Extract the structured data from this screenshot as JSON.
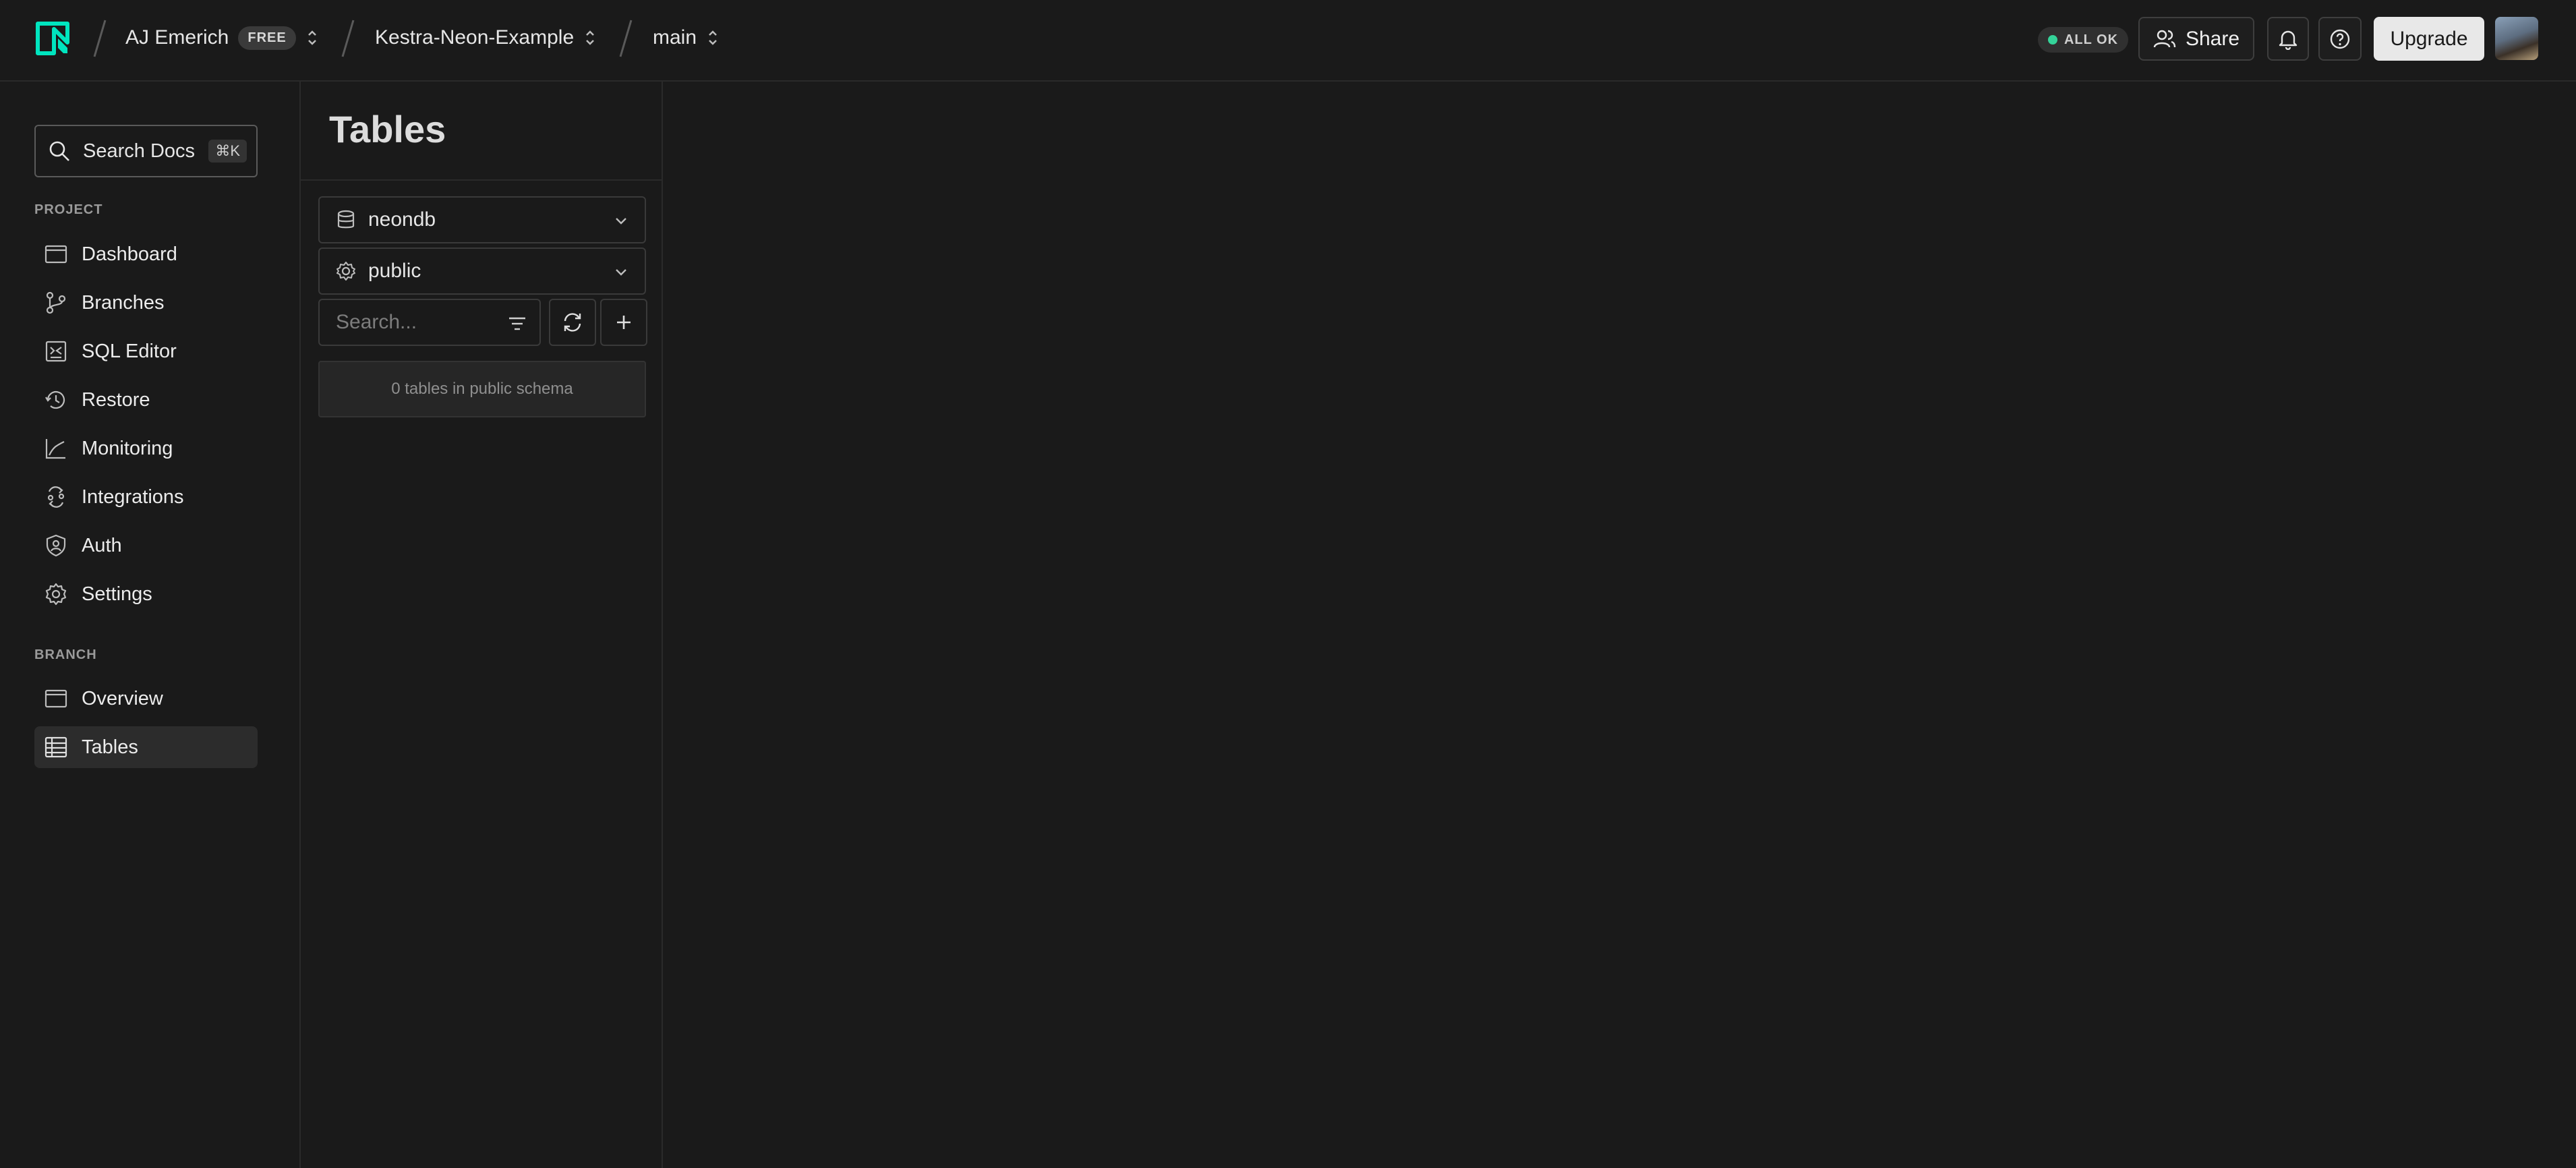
{
  "header": {
    "org_name": "AJ Emerich",
    "plan_badge": "FREE",
    "project_name": "Kestra-Neon-Example",
    "branch_name": "main",
    "status_text": "ALL OK",
    "share_label": "Share",
    "upgrade_label": "Upgrade",
    "colors": {
      "accent": "#00e5bf",
      "status_ok": "#34d399"
    }
  },
  "sidebar": {
    "search_label": "Search Docs",
    "search_shortcut": "⌘K",
    "project_section_label": "PROJECT",
    "project_items": [
      {
        "label": "Dashboard",
        "icon": "dashboard-icon"
      },
      {
        "label": "Branches",
        "icon": "branches-icon"
      },
      {
        "label": "SQL Editor",
        "icon": "sql-editor-icon"
      },
      {
        "label": "Restore",
        "icon": "restore-icon"
      },
      {
        "label": "Monitoring",
        "icon": "monitoring-icon"
      },
      {
        "label": "Integrations",
        "icon": "integrations-icon"
      },
      {
        "label": "Auth",
        "icon": "auth-icon"
      },
      {
        "label": "Settings",
        "icon": "settings-icon"
      }
    ],
    "branch_section_label": "BRANCH",
    "branch_items": [
      {
        "label": "Overview",
        "icon": "overview-icon"
      },
      {
        "label": "Tables",
        "icon": "tables-icon",
        "active": true
      }
    ]
  },
  "tables_panel": {
    "title": "Tables",
    "database_select": "neondb",
    "schema_select": "public",
    "search_placeholder": "Search...",
    "empty_message": "0 tables in public schema"
  }
}
